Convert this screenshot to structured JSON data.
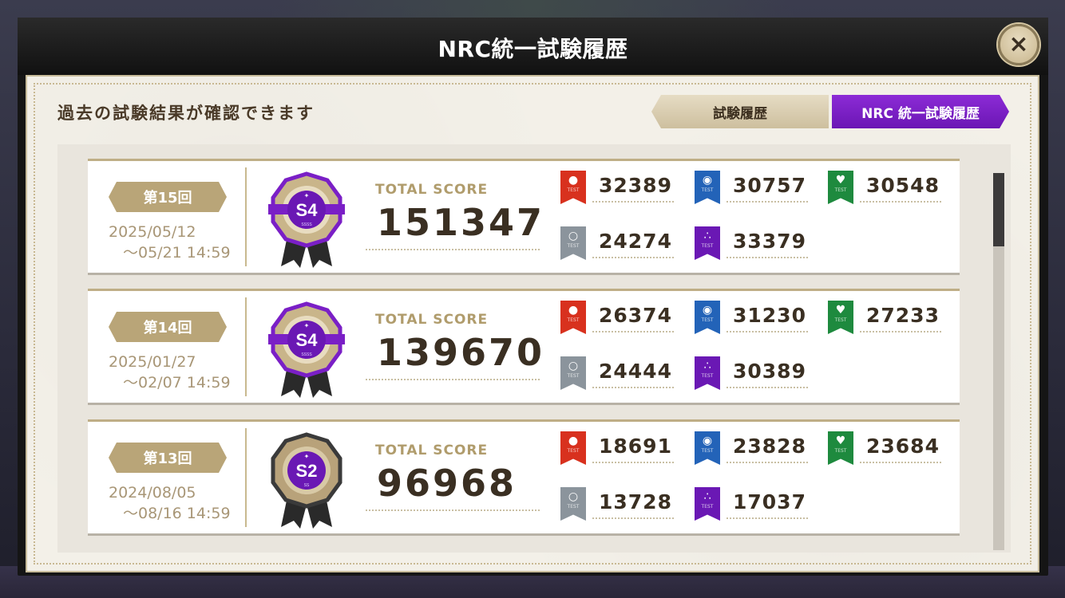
{
  "window": {
    "title": "NRC統一試験履歴",
    "close_icon": "×"
  },
  "header": {
    "subtitle": "過去の試験結果が確認できます",
    "tabs": [
      {
        "label": "試験履歴",
        "active": false
      },
      {
        "label": "NRC 統一試験履歴",
        "active": true
      }
    ]
  },
  "total_score_label": "TOTAL SCORE",
  "subject_test_label": "TEST",
  "records": [
    {
      "round": "第15回",
      "date_start": "2025/05/12",
      "date_end": "〜05/21 14:59",
      "rank": "S4",
      "rank_sub": "SSSS",
      "medal_style": "gold-purple",
      "total": "151347",
      "scores": {
        "red": "32389",
        "blue": "30757",
        "green": "30548",
        "gray": "24274",
        "purple": "33379"
      }
    },
    {
      "round": "第14回",
      "date_start": "2025/01/27",
      "date_end": "〜02/07 14:59",
      "rank": "S4",
      "rank_sub": "SSSS",
      "medal_style": "gold-purple",
      "total": "139670",
      "scores": {
        "red": "26374",
        "blue": "31230",
        "green": "27233",
        "gray": "24444",
        "purple": "30389"
      }
    },
    {
      "round": "第13回",
      "date_start": "2024/08/05",
      "date_end": "〜08/16 14:59",
      "rank": "S2",
      "rank_sub": "SS",
      "medal_style": "dark-purple",
      "total": "96968",
      "scores": {
        "red": "18691",
        "blue": "23828",
        "green": "23684",
        "gray": "13728",
        "purple": "17037"
      }
    }
  ],
  "subject_colors": {
    "red": "#d8311e",
    "blue": "#2363b8",
    "green": "#1e8a3e",
    "gray": "#8b949c",
    "purple": "#6a18b4"
  },
  "subject_icons": {
    "red": "flame-icon",
    "blue": "orb-icon",
    "green": "leaf-icon",
    "gray": "dot-ring-icon",
    "purple": "bubbles-icon"
  },
  "accent_color": "#7a1fc6"
}
